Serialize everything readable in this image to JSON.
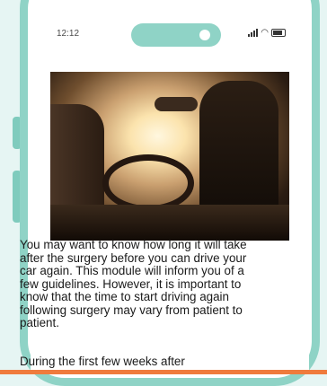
{
  "status_bar": {
    "time": "12:12",
    "wifi_icon": "wifi-icon",
    "battery_icon": "battery-icon"
  },
  "content": {
    "image_icon": "car-interior-photo",
    "paragraph": "You may want to know how long it will take after the surgery before you can drive your car again. This module will inform you of a few guidelines. However, it is important to know that the time to start driving again following surgery may vary from patient to patient.",
    "paragraph2": "During the first few weeks after"
  },
  "colors": {
    "phone_frame": "#8fd3c6",
    "background": "#e6f5f3",
    "accent_bar": "#ef7b3d"
  }
}
